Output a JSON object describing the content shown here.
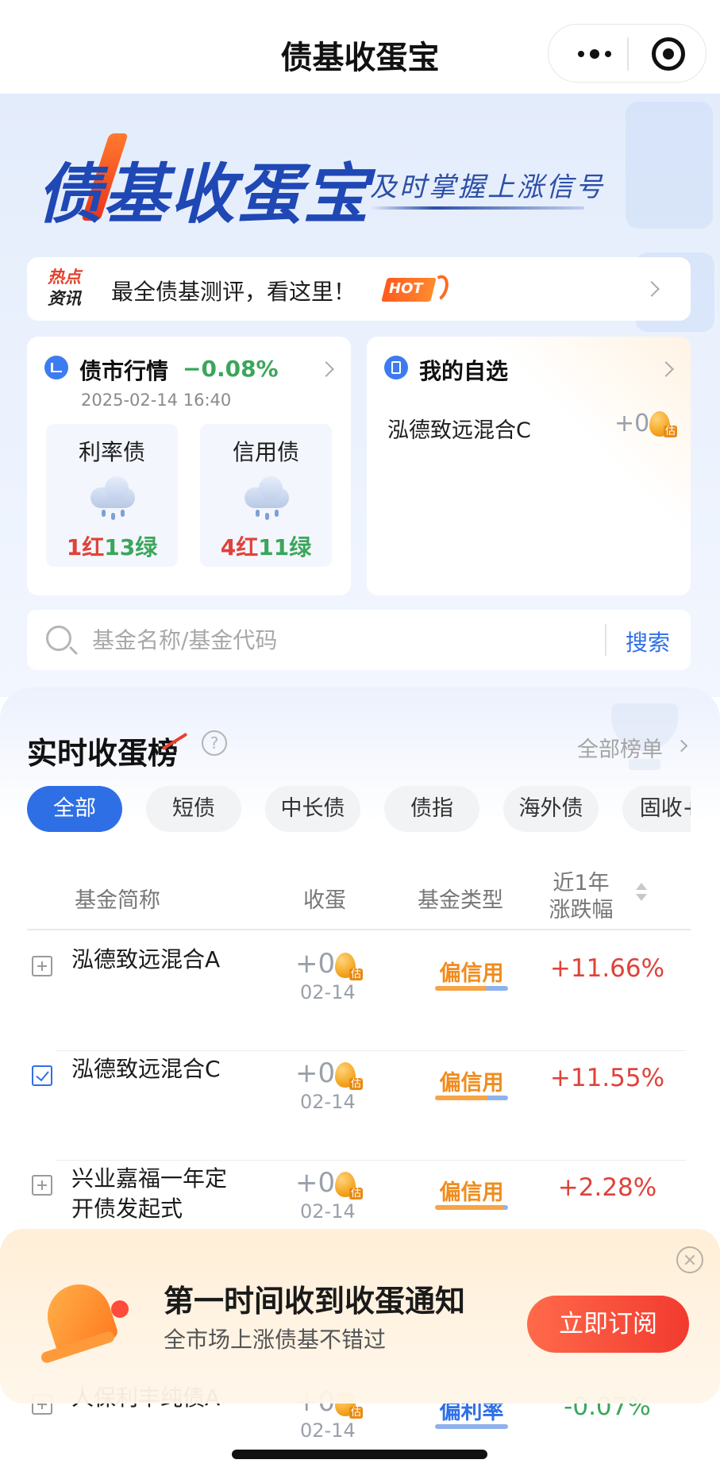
{
  "nav": {
    "title": "债基收蛋宝"
  },
  "hero": {
    "brand": "债基收蛋宝",
    "slogan": "及时掌握上涨信号"
  },
  "news": {
    "tag_line1": "热点",
    "tag_line2": "资讯",
    "text": "最全债基测评，看这里！",
    "badge": "HOT"
  },
  "market": {
    "title": "债市行情",
    "change": "−0.08%",
    "time": "2025-02-14 16:40",
    "boxes": [
      {
        "label": "利率债",
        "red": "1红",
        "green": "13绿"
      },
      {
        "label": "信用债",
        "red": "4红",
        "green": "11绿"
      }
    ]
  },
  "mine": {
    "title": "我的自选",
    "item_name": "泓德致远混合C",
    "item_value": "+0",
    "est": "估"
  },
  "search": {
    "placeholder": "基金名称/基金代码",
    "button": "搜索"
  },
  "ranking": {
    "title": "实时收蛋榜",
    "help": "?",
    "all_list": "全部榜单",
    "tabs": [
      "全部",
      "短债",
      "中长债",
      "债指",
      "海外债",
      "固收+"
    ],
    "active_tab": 0,
    "columns": {
      "name": "基金简称",
      "egg": "收蛋",
      "type": "基金类型",
      "change_l1": "近1年",
      "change_l2": "涨跌幅"
    },
    "rows": [
      {
        "name": "泓德致远混合A",
        "egg": "+0",
        "date": "02-14",
        "type": "偏信用",
        "change": "+11.66%",
        "checked": false
      },
      {
        "name": "泓德致远混合C",
        "egg": "+0",
        "date": "02-14",
        "type": "偏信用",
        "change": "+11.55%",
        "checked": true
      },
      {
        "name": "兴业嘉福一年定开债发起式",
        "egg": "+0",
        "date": "02-14",
        "type": "偏信用",
        "change": "+2.28%",
        "checked": false
      },
      {
        "name": "人保利丰纯债A",
        "egg": "+0",
        "date": "02-14",
        "type": "偏利率",
        "change": "-0.07%",
        "checked": false
      }
    ]
  },
  "banner": {
    "title": "第一时间收到收蛋通知",
    "subtitle": "全市场上涨债基不错过",
    "button": "立即订阅"
  },
  "colors": {
    "primary": "#2f6fe6",
    "up": "#e0423a",
    "down": "#3aa65a",
    "credit": "#f08c1e",
    "rate": "#2f6fe6"
  }
}
